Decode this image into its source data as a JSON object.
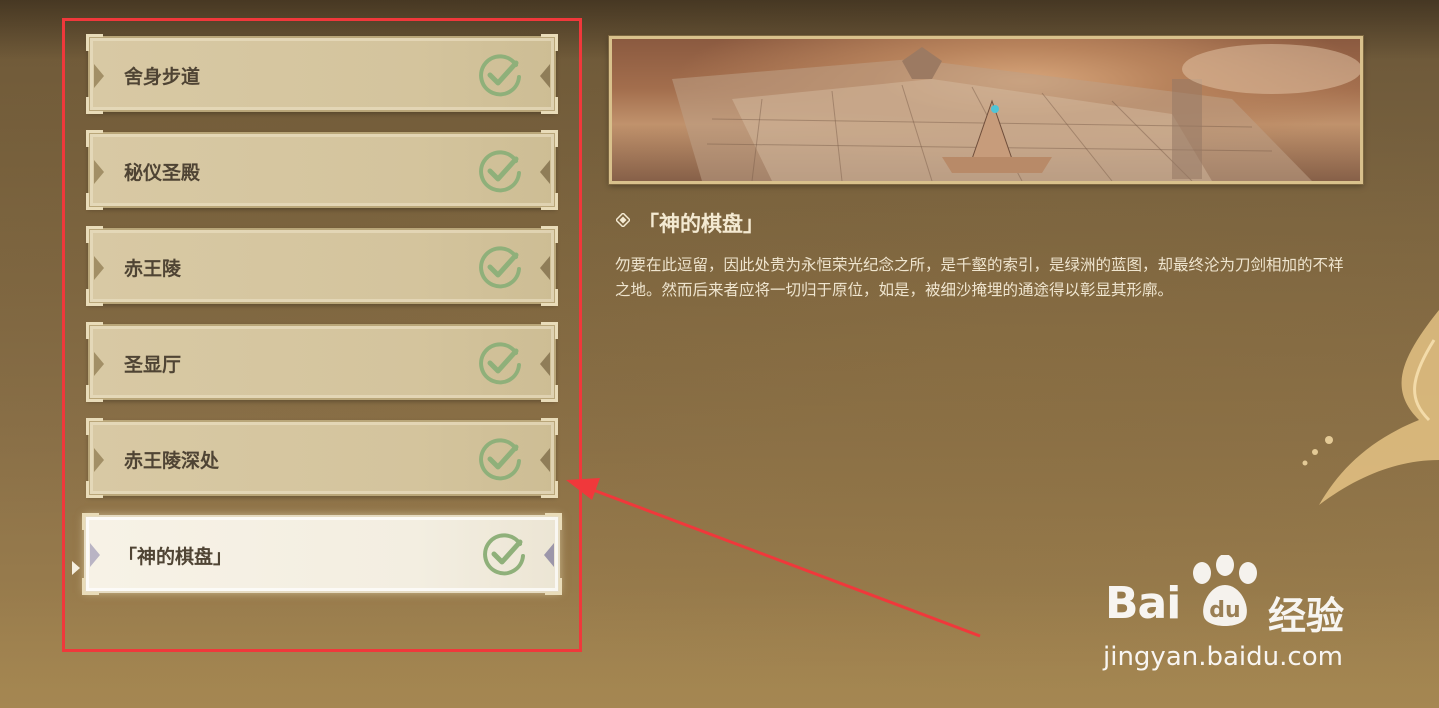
{
  "domain_list": {
    "items": [
      {
        "label": "舍身步道",
        "completed": true
      },
      {
        "label": "秘仪圣殿",
        "completed": true
      },
      {
        "label": "赤王陵",
        "completed": true
      },
      {
        "label": "圣显厅",
        "completed": true
      },
      {
        "label": "赤王陵深处",
        "completed": true
      },
      {
        "label": "「神的棋盘」",
        "completed": true,
        "selected": true
      }
    ]
  },
  "detail": {
    "title": "「神的棋盘」",
    "description": "勿要在此逗留，因此处贵为永恒荣光纪念之所，是千壑的索引，是绿洲的蓝图，却最终沦为刀剑相加的不祥之地。然而后来者应将一切归于原位，如是，被细沙掩埋的通途得以彰显其形廓。"
  },
  "watermark": {
    "brand": "Bai",
    "brand_suffix": "经验",
    "url": "jingyan.baidu.com"
  },
  "colors": {
    "highlight_frame": "#f0383b",
    "check": "#8fb07a",
    "card_bg": "#d6c69f",
    "card_selected_bg": "#f5f0e3"
  }
}
